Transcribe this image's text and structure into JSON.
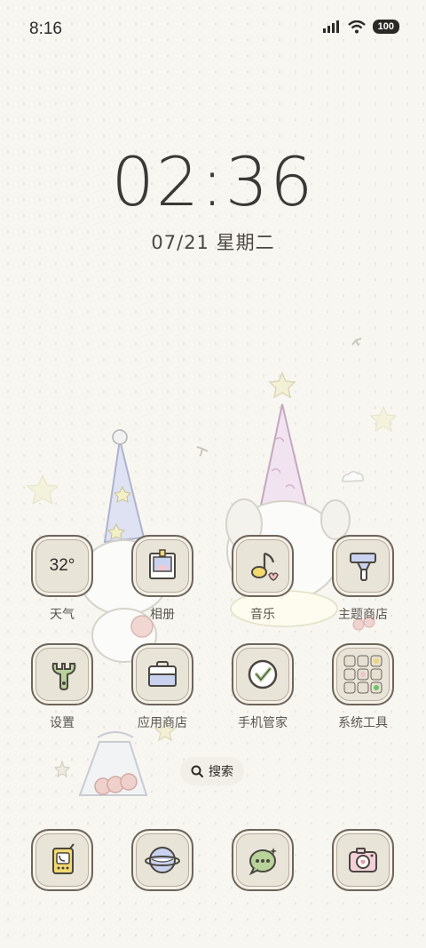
{
  "status_bar": {
    "time": "8:16",
    "battery": "100",
    "icons": [
      "signal-icon",
      "wifi-icon",
      "battery-icon"
    ]
  },
  "lock_clock": {
    "time": "02:36",
    "date": "07/21 星期二"
  },
  "apps_row1": [
    {
      "label": "天气",
      "icon": "weather-icon",
      "value": "32°"
    },
    {
      "label": "相册",
      "icon": "photo-icon"
    },
    {
      "label": "音乐",
      "icon": "music-icon"
    },
    {
      "label": "主题商店",
      "icon": "theme-store-icon"
    }
  ],
  "apps_row2": [
    {
      "label": "设置",
      "icon": "settings-icon"
    },
    {
      "label": "应用商店",
      "icon": "app-store-icon"
    },
    {
      "label": "手机管家",
      "icon": "phone-manager-icon"
    },
    {
      "label": "系统工具",
      "icon": "system-tools-folder-icon"
    }
  ],
  "search": {
    "label": "搜索"
  },
  "dock": [
    {
      "icon": "phone-icon"
    },
    {
      "icon": "browser-icon"
    },
    {
      "icon": "messages-icon"
    },
    {
      "icon": "camera-icon"
    }
  ],
  "colors": {
    "background": "#f7f6f1",
    "tile": "#e8e4d8",
    "tile_border": "#6e655b",
    "text": "#4a4640"
  }
}
